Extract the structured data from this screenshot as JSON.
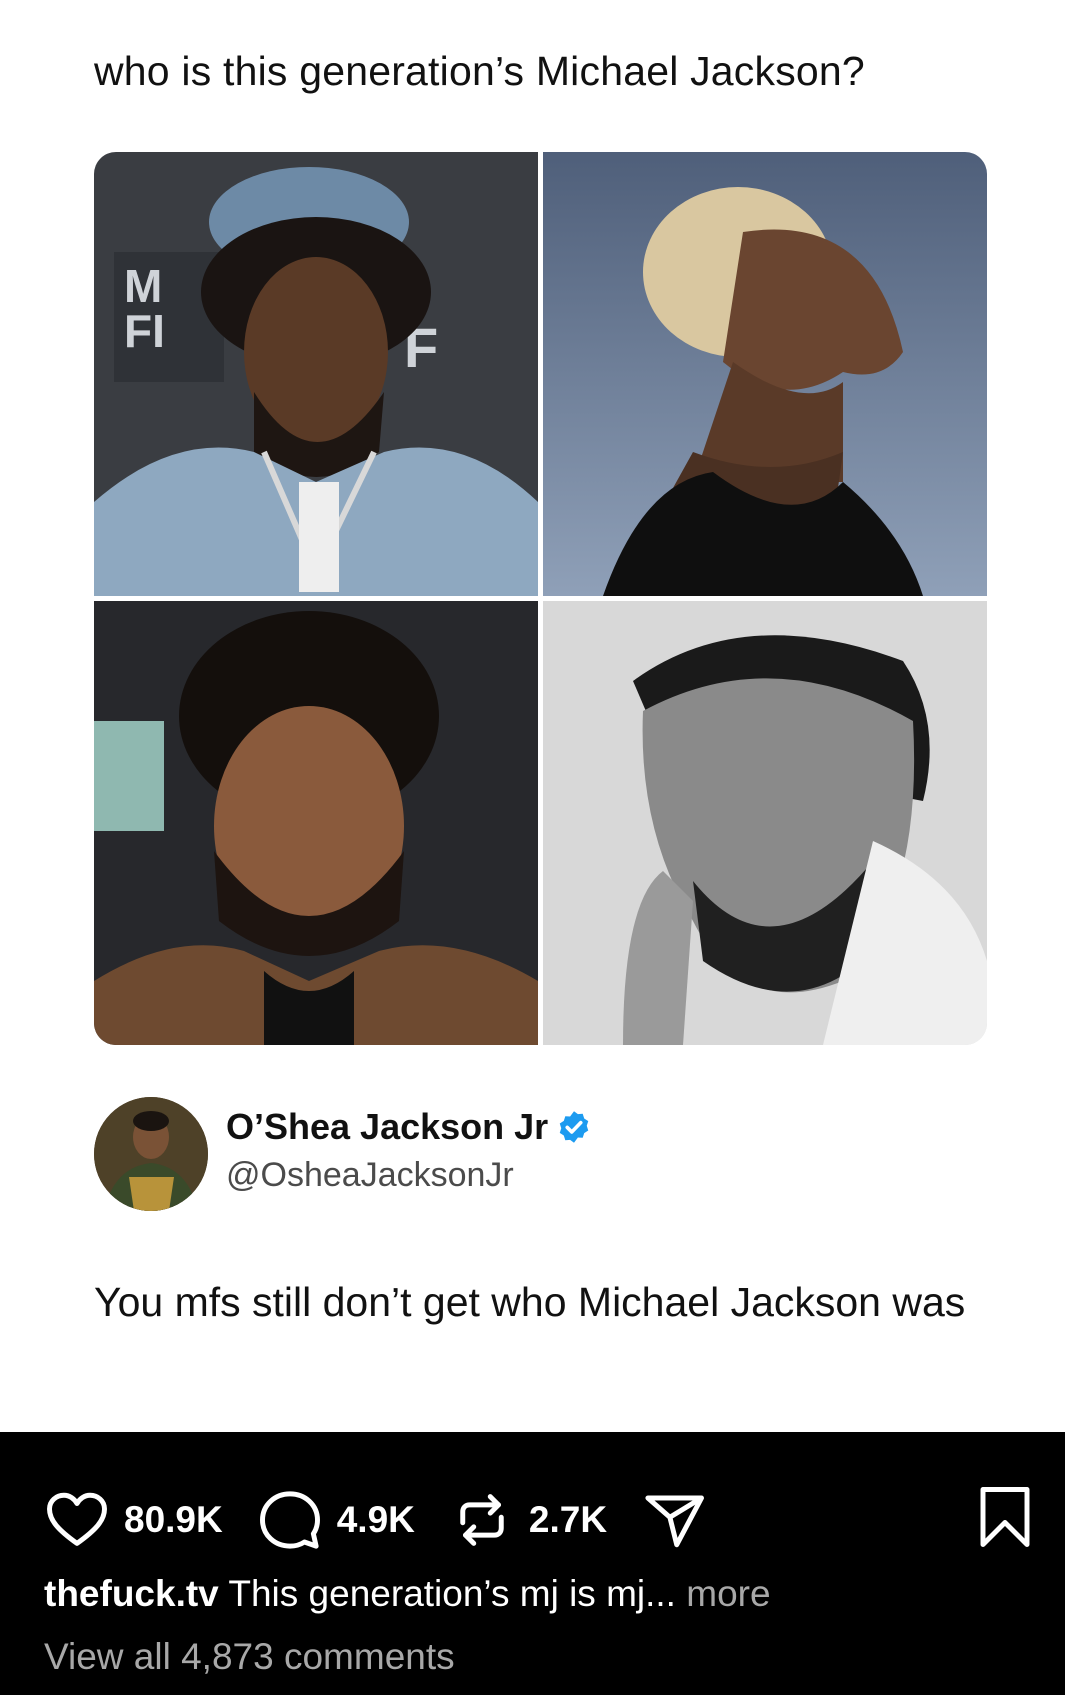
{
  "post": {
    "question": "who is this generation’s Michael Jackson?",
    "images": [
      {
        "label": "photo-top-left"
      },
      {
        "label": "photo-top-right"
      },
      {
        "label": "photo-bottom-left"
      },
      {
        "label": "photo-bottom-right"
      }
    ]
  },
  "reply": {
    "name": "O’Shea Jackson Jr",
    "handle": "@OsheaJacksonJr",
    "text": "You mfs still don’t get who Michael Jackson was",
    "verified_color": "#1d9bf0"
  },
  "instagram": {
    "likes": "80.9K",
    "comments": "4.9K",
    "reposts": "2.7K",
    "caption_user": "thefuck.tv",
    "caption_text": " This generation’s mj is mj...",
    "more_label": " more",
    "view_all": "View all 4,873 comments"
  }
}
